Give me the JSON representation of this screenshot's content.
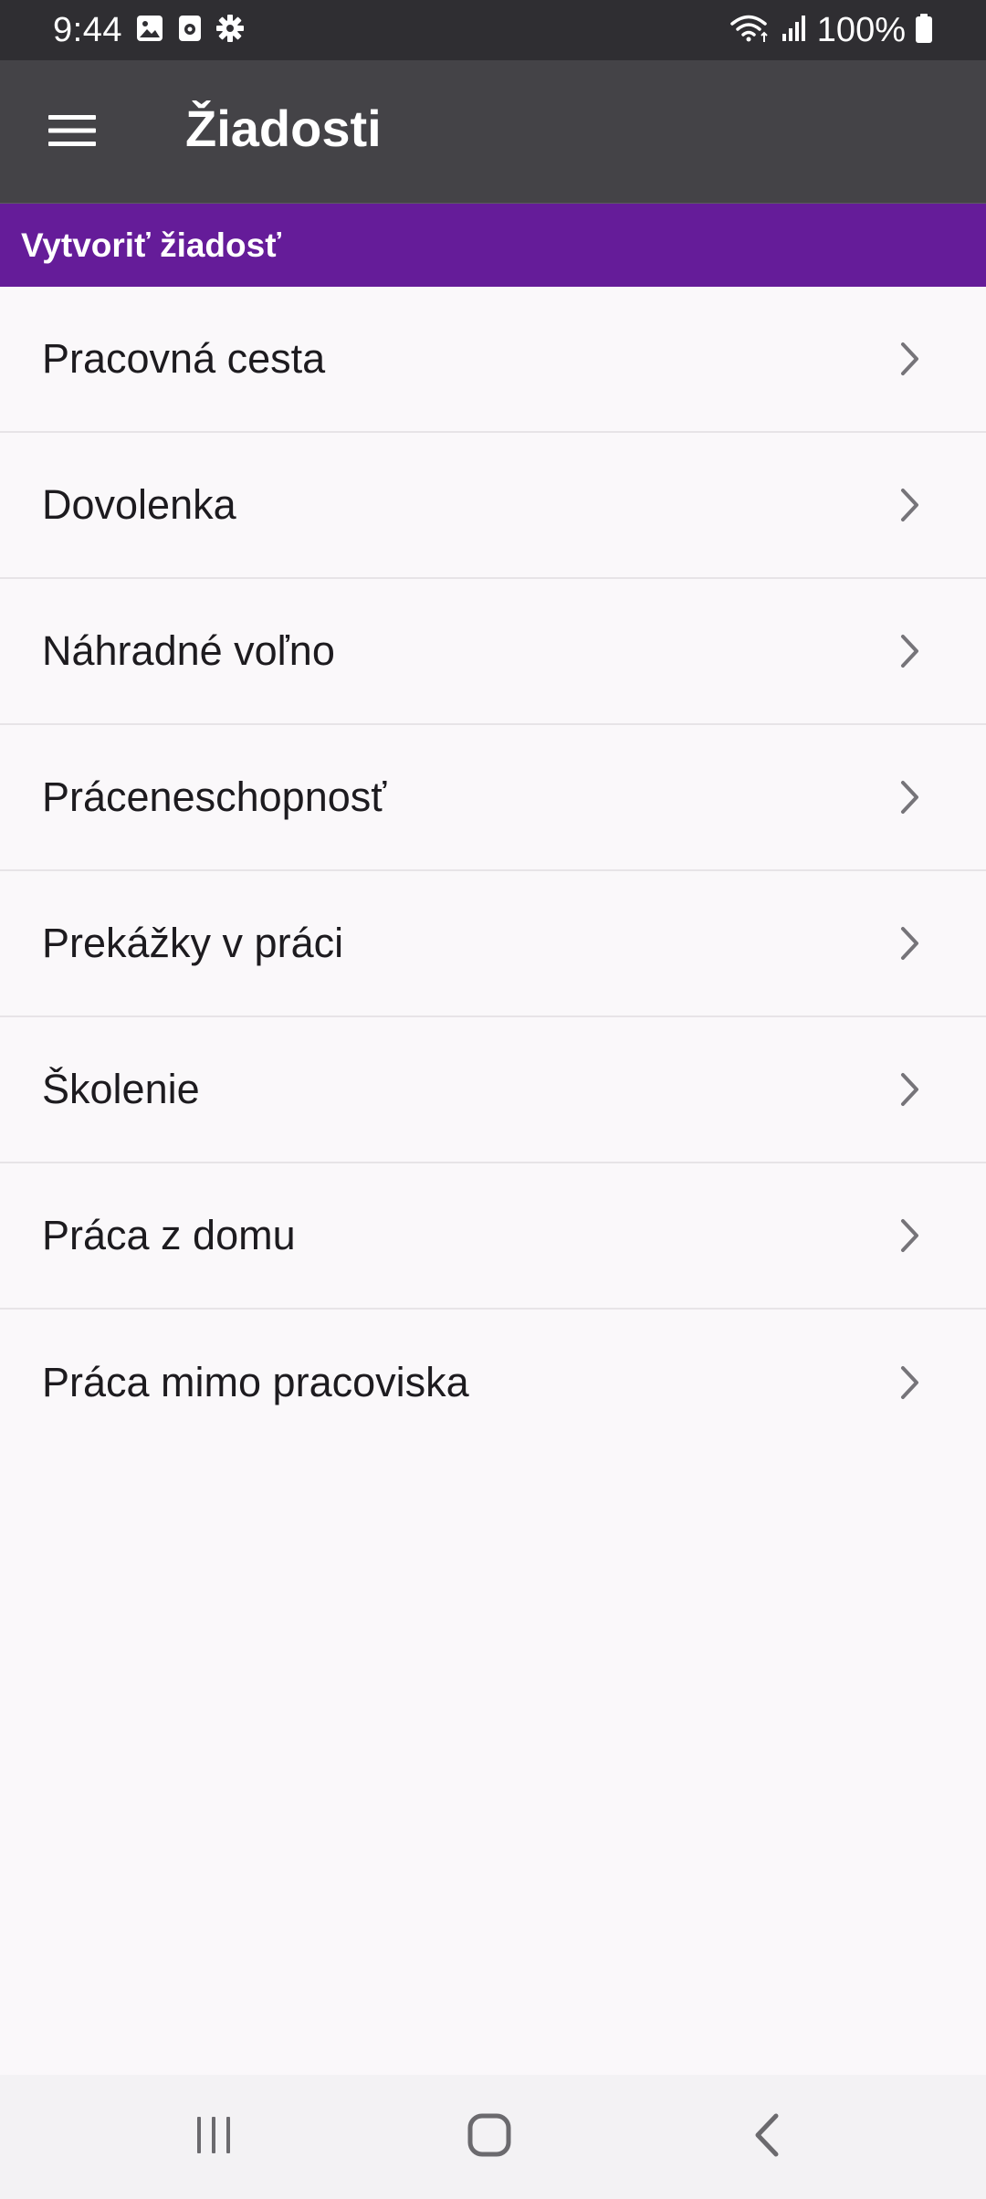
{
  "status_bar": {
    "time": "9:44",
    "battery": "100%",
    "icons_left": [
      "gallery-icon",
      "sim-card-icon",
      "settings-icon"
    ],
    "icons_right": [
      "wifi-icon",
      "signal-icon",
      "battery-icon"
    ]
  },
  "app_bar": {
    "title": "Žiadosti",
    "menu_icon": "hamburger-menu-icon"
  },
  "section": {
    "header": "Vytvoriť žiadosť"
  },
  "requests": [
    {
      "label": "Pracovná cesta"
    },
    {
      "label": "Dovolenka"
    },
    {
      "label": "Náhradné voľno"
    },
    {
      "label": "Práceneschopnosť"
    },
    {
      "label": "Prekážky v práci"
    },
    {
      "label": "Školenie"
    },
    {
      "label": "Práca z domu"
    },
    {
      "label": "Práca mimo pracoviska"
    }
  ],
  "nav_bar": {
    "buttons": [
      "recent-apps-icon",
      "home-icon",
      "back-icon"
    ]
  },
  "colors": {
    "status_bar": "#2f2e32",
    "app_bar": "#444347",
    "accent": "#651c99",
    "background": "#faf8fa",
    "divider": "#e7e4e7",
    "chevron": "#767479"
  }
}
